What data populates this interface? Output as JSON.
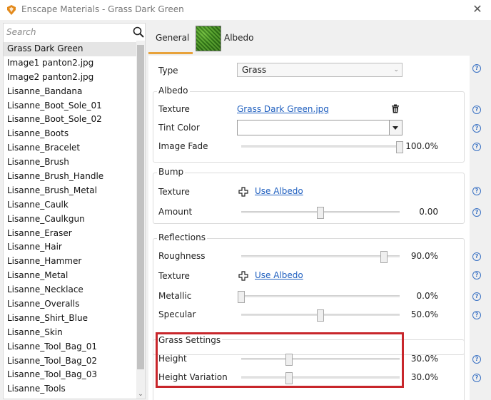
{
  "window": {
    "title": "Enscape Materials - Grass Dark Green"
  },
  "search": {
    "placeholder": "Search"
  },
  "materials": [
    "Grass Dark Green",
    "Image1 panton2.jpg",
    "Image2 panton2.jpg",
    "Lisanne_Bandana",
    "Lisanne_Boot_Sole_01",
    "Lisanne_Boot_Sole_02",
    "Lisanne_Boots",
    "Lisanne_Bracelet",
    "Lisanne_Brush",
    "Lisanne_Brush_Handle",
    "Lisanne_Brush_Metal",
    "Lisanne_Caulk",
    "Lisanne_Caulkgun",
    "Lisanne_Eraser",
    "Lisanne_Hair",
    "Lisanne_Hammer",
    "Lisanne_Metal",
    "Lisanne_Necklace",
    "Lisanne_Overalls",
    "Lisanne_Shirt_Blue",
    "Lisanne_Skin",
    "Lisanne_Tool_Bag_01",
    "Lisanne_Tool_Bag_02",
    "Lisanne_Tool_Bag_03",
    "Lisanne_Tools"
  ],
  "selected_material": "Grass Dark Green",
  "tabs": {
    "general": "General",
    "albedo": "Albedo",
    "active": "General"
  },
  "type": {
    "label": "Type",
    "value": "Grass"
  },
  "albedo": {
    "title": "Albedo",
    "texture_label": "Texture",
    "texture_value": "Grass Dark Green.jpg",
    "tint_label": "Tint Color",
    "fade_label": "Image Fade",
    "fade_value": "100.0%",
    "fade_level": 1.0
  },
  "bump": {
    "title": "Bump",
    "texture_label": "Texture",
    "texture_link": "Use Albedo",
    "amount_label": "Amount",
    "amount_value": "0.00",
    "amount_level": 0.5
  },
  "reflections": {
    "title": "Reflections",
    "roughness_label": "Roughness",
    "roughness_value": "90.0%",
    "roughness_level": 0.9,
    "texture_label": "Texture",
    "texture_link": "Use Albedo",
    "metallic_label": "Metallic",
    "metallic_value": "0.0%",
    "metallic_level": 0.0,
    "specular_label": "Specular",
    "specular_value": "50.0%",
    "specular_level": 0.5
  },
  "grass": {
    "title": "Grass Settings",
    "height_label": "Height",
    "height_value": "30.0%",
    "height_level": 0.3,
    "variation_label": "Height Variation",
    "variation_value": "30.0%",
    "variation_level": 0.3
  },
  "help_glyph": "?",
  "colors": {
    "accent": "#e8a23a",
    "link": "#1f5fbf",
    "highlight": "#c8262b"
  }
}
